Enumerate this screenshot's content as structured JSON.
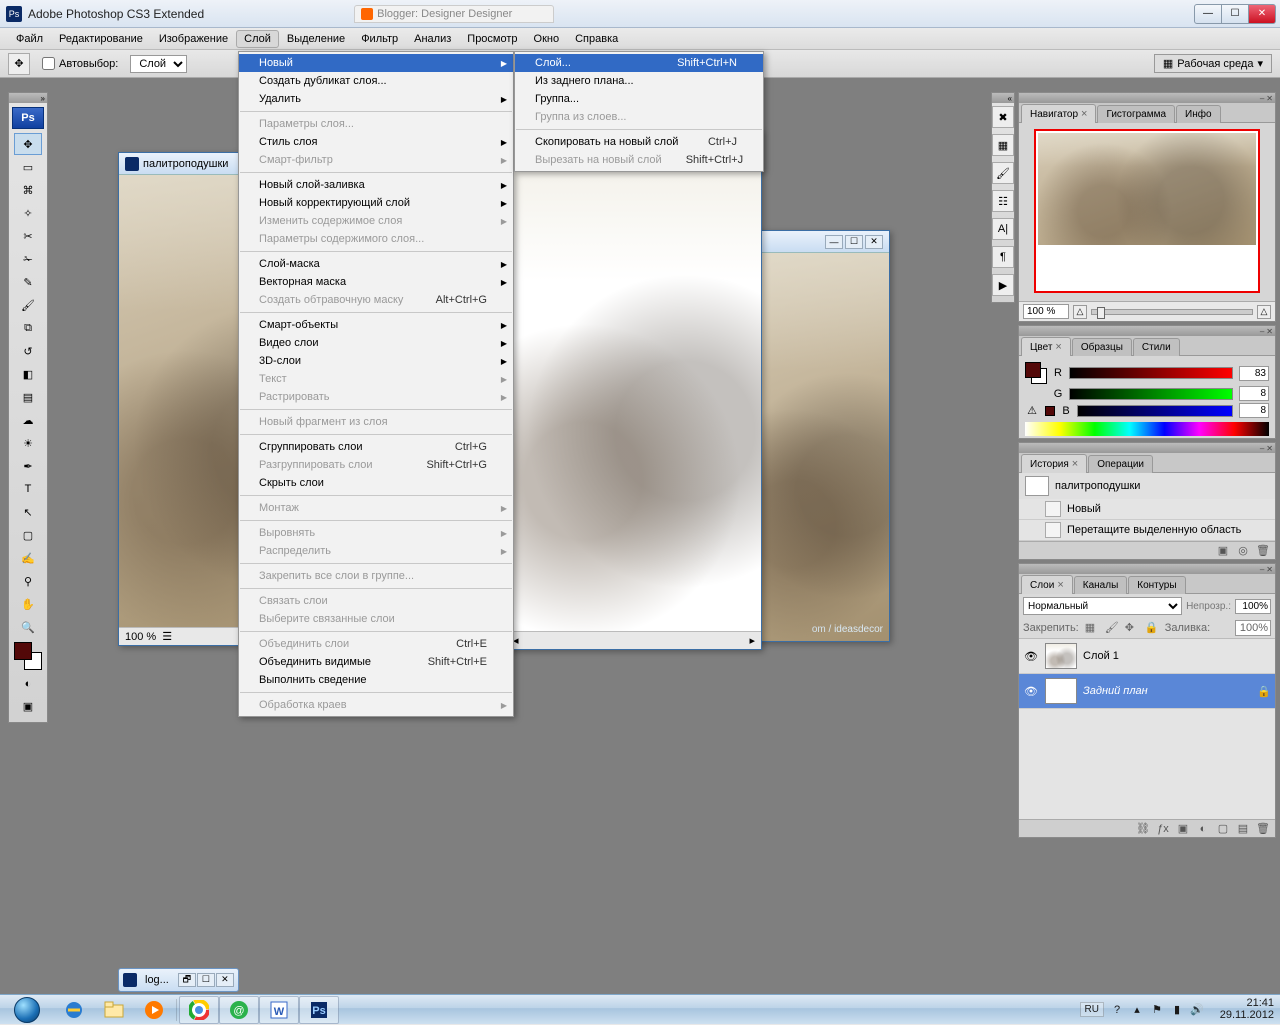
{
  "titlebar": {
    "app": "Adobe Photoshop CS3 Extended",
    "ghost_tab": "Blogger: Designer Designer"
  },
  "menubar": [
    "Файл",
    "Редактирование",
    "Изображение",
    "Слой",
    "Выделение",
    "Фильтр",
    "Анализ",
    "Просмотр",
    "Окно",
    "Справка"
  ],
  "menubar_active_index": 3,
  "options": {
    "autoselect_label": "Автовыбор:",
    "autoselect_value": "Слой",
    "workspace": "Рабочая среда"
  },
  "layer_menu": {
    "items": [
      {
        "label": "Новый",
        "sub": true,
        "hl": true
      },
      {
        "label": "Создать дубликат слоя..."
      },
      {
        "label": "Удалить",
        "sub": true
      },
      {
        "sep": true
      },
      {
        "label": "Параметры слоя...",
        "dis": true
      },
      {
        "label": "Стиль слоя",
        "sub": true
      },
      {
        "label": "Смарт-фильтр",
        "sub": true,
        "dis": true
      },
      {
        "sep": true
      },
      {
        "label": "Новый слой-заливка",
        "sub": true
      },
      {
        "label": "Новый корректирующий слой",
        "sub": true
      },
      {
        "label": "Изменить содержимое слоя",
        "sub": true,
        "dis": true
      },
      {
        "label": "Параметры содержимого слоя...",
        "dis": true
      },
      {
        "sep": true
      },
      {
        "label": "Слой-маска",
        "sub": true
      },
      {
        "label": "Векторная маска",
        "sub": true
      },
      {
        "label": "Создать обтравочную маску",
        "shortcut": "Alt+Ctrl+G",
        "dis": true
      },
      {
        "sep": true
      },
      {
        "label": "Смарт-объекты",
        "sub": true
      },
      {
        "label": "Видео слои",
        "sub": true
      },
      {
        "label": "3D-слои",
        "sub": true
      },
      {
        "label": "Текст",
        "sub": true,
        "dis": true
      },
      {
        "label": "Растрировать",
        "sub": true,
        "dis": true
      },
      {
        "sep": true
      },
      {
        "label": "Новый фрагмент из слоя",
        "dis": true
      },
      {
        "sep": true
      },
      {
        "label": "Сгруппировать слои",
        "shortcut": "Ctrl+G"
      },
      {
        "label": "Разгруппировать слои",
        "shortcut": "Shift+Ctrl+G",
        "dis": true
      },
      {
        "label": "Скрыть слои"
      },
      {
        "sep": true
      },
      {
        "label": "Монтаж",
        "sub": true,
        "dis": true
      },
      {
        "sep": true
      },
      {
        "label": "Выровнять",
        "sub": true,
        "dis": true
      },
      {
        "label": "Распределить",
        "sub": true,
        "dis": true
      },
      {
        "sep": true
      },
      {
        "label": "Закрепить все слои в группе...",
        "dis": true
      },
      {
        "sep": true
      },
      {
        "label": "Связать слои",
        "dis": true
      },
      {
        "label": "Выберите связанные слои",
        "dis": true
      },
      {
        "sep": true
      },
      {
        "label": "Объединить слои",
        "shortcut": "Ctrl+E",
        "dis": true
      },
      {
        "label": "Объединить видимые",
        "shortcut": "Shift+Ctrl+E"
      },
      {
        "label": "Выполнить сведение"
      },
      {
        "sep": true
      },
      {
        "label": "Обработка краев",
        "sub": true,
        "dis": true
      }
    ]
  },
  "new_submenu": [
    {
      "label": "Слой...",
      "shortcut": "Shift+Ctrl+N",
      "hl": true
    },
    {
      "label": "Из заднего плана..."
    },
    {
      "label": "Группа..."
    },
    {
      "label": "Группа из слоев...",
      "dis": true
    },
    {
      "sep": true
    },
    {
      "label": "Скопировать на новый слой",
      "shortcut": "Ctrl+J"
    },
    {
      "label": "Вырезать на новый слой",
      "shortcut": "Shift+Ctrl+J",
      "dis": true
    }
  ],
  "doc1": {
    "title": "палитроподушки",
    "zoom": "100 %"
  },
  "doc3_watermark": "om / ideasdecor",
  "min_doc": "log...",
  "navigator": {
    "tabs": [
      "Навигатор",
      "Гистограмма",
      "Инфо"
    ],
    "zoom": "100 %"
  },
  "color": {
    "tabs": [
      "Цвет",
      "Образцы",
      "Стили"
    ],
    "fg": "#530808",
    "r": "83",
    "g": "8",
    "b": "8"
  },
  "history": {
    "tabs": [
      "История",
      "Операции"
    ],
    "doc": "палитроподушки",
    "items": [
      "Новый",
      "Перетащите выделенную область"
    ]
  },
  "layers": {
    "tabs": [
      "Слои",
      "Каналы",
      "Контуры"
    ],
    "blend": "Нормальный",
    "opacity_label": "Непрозр.:",
    "opacity": "100%",
    "lock_label": "Закрепить:",
    "fill_label": "Заливка:",
    "fill": "100%",
    "list": [
      {
        "name": "Слой 1",
        "bg": false
      },
      {
        "name": "Задний план",
        "bg": true,
        "sel": true,
        "locked": true
      }
    ]
  },
  "taskbar": {
    "lang": "RU",
    "time": "21:41",
    "date": "29.11.2012"
  }
}
